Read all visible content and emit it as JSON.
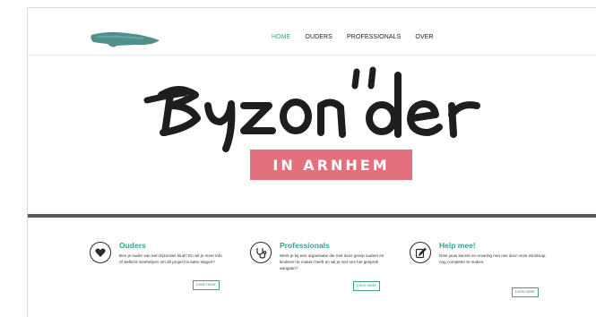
{
  "nav": {
    "items": [
      {
        "label": "HOME",
        "active": true
      },
      {
        "label": "OUDERS",
        "active": false
      },
      {
        "label": "PROFESSIONALS",
        "active": false
      },
      {
        "label": "OVER",
        "active": false
      }
    ]
  },
  "hero": {
    "title": "Byzonder",
    "subtitle": "IN ARNHEM"
  },
  "features": [
    {
      "icon": "heart-icon",
      "title": "Ouders",
      "text": "Ben je ouder van een bijzonder kind? En wil je meer info of wellicht meehelpen om dit project te laten slagen?",
      "button": "Lees meer"
    },
    {
      "icon": "stethoscope-icon",
      "title": "Professionals",
      "text": "Werk je bij een organisatie die met deze groep ouders en kinderen te maken heeft en wil je met ons het gesprek aangaan?",
      "button": "Lees meer"
    },
    {
      "icon": "edit-icon",
      "title": "Help mee!",
      "text": "Deel jouw kennis en ervaring met ons door onze mindmap nog completer te maken.",
      "button": "Lees meer"
    }
  ],
  "colors": {
    "accent": "#3aa08a",
    "badge": "#e2717d",
    "divider": "#575757",
    "logo": "#4f8f8c"
  }
}
